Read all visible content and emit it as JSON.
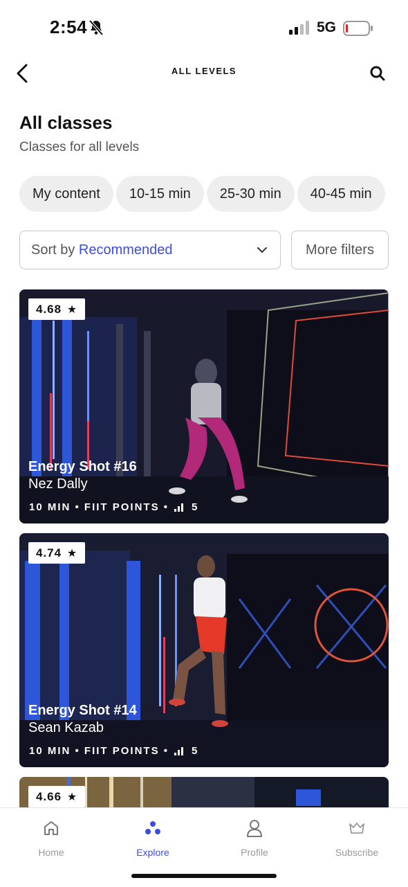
{
  "status": {
    "time": "2:54",
    "network": "5G"
  },
  "nav": {
    "title": "ALL LEVELS"
  },
  "header": {
    "title": "All classes",
    "subtitle": "Classes for all levels"
  },
  "chips": [
    "My content",
    "10-15 min",
    "25-30 min",
    "40-45 min"
  ],
  "sort": {
    "prefix": "Sort by",
    "value": "Recommended"
  },
  "filters": {
    "label": "More filters"
  },
  "cards": [
    {
      "rating": "4.68",
      "title": "Energy Shot #16",
      "instructor": "Nez Dally",
      "meta_left": "10 MIN • FIIT POINTS •",
      "meta_level": "5"
    },
    {
      "rating": "4.74",
      "title": "Energy Shot #14",
      "instructor": "Sean Kazab",
      "meta_left": "10 MIN • FIIT POINTS •",
      "meta_level": "5"
    },
    {
      "rating": "4.66"
    }
  ],
  "tabs": [
    {
      "label": "Home",
      "icon": "home-icon"
    },
    {
      "label": "Explore",
      "icon": "explore-icon",
      "active": true
    },
    {
      "label": "Profile",
      "icon": "profile-icon"
    },
    {
      "label": "Subscribe",
      "icon": "crown-icon"
    }
  ],
  "colors": {
    "accent": "#3b4ce0",
    "chip_bg": "#eeeeee",
    "battery_low": "#e02424"
  }
}
